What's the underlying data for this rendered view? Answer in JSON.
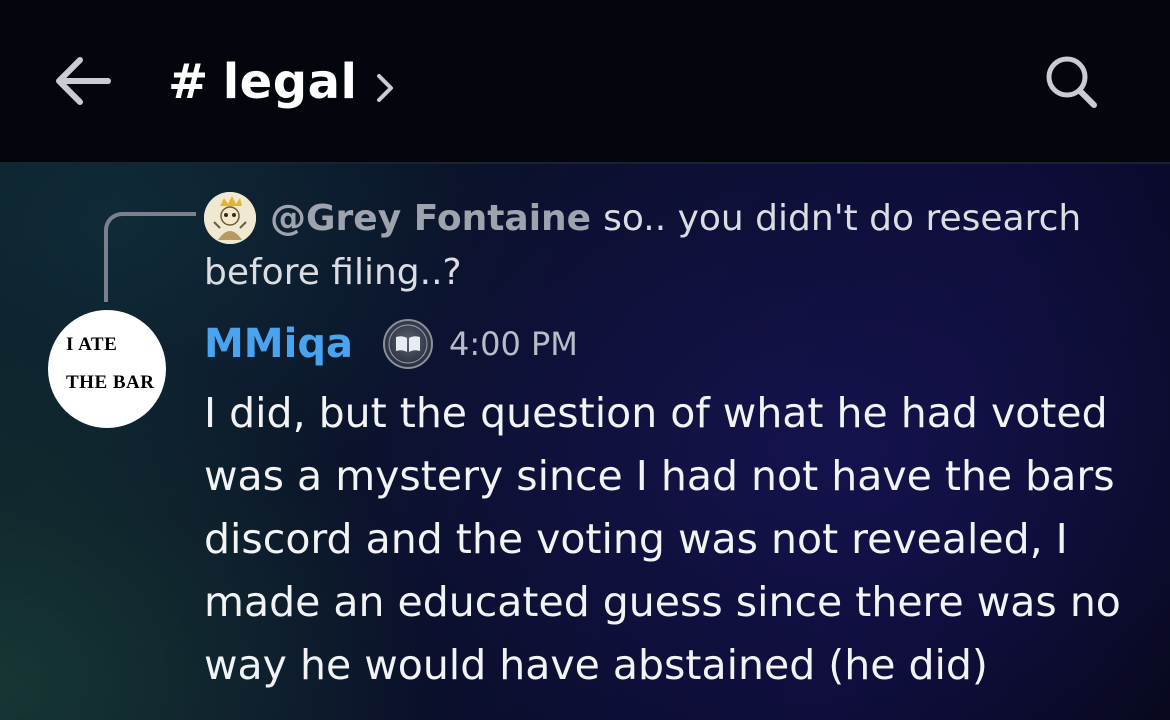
{
  "header": {
    "back_icon": "arrow-left-icon",
    "channel_hash": "#",
    "channel_name": "legal",
    "chevron_icon": "chevron-right-icon",
    "search_icon": "search-icon"
  },
  "reply": {
    "author": "@Grey Fontaine",
    "text_line1": "so.. you didn't do research",
    "text_line2": "before filing..?"
  },
  "message": {
    "avatar_line1": "I ATE",
    "avatar_line2": "THE BAR",
    "username": "MMiqa",
    "username_color": "#4aa3ef",
    "badge_icon": "book-badge-icon",
    "timestamp": "4:00 PM",
    "lines": [
      "I did, but the question of what he had voted",
      "was a mystery since I had not have the bars",
      "discord and the voting was not revealed, I",
      "made an educated guess since there was no",
      "way he would have abstained (he did)"
    ]
  }
}
